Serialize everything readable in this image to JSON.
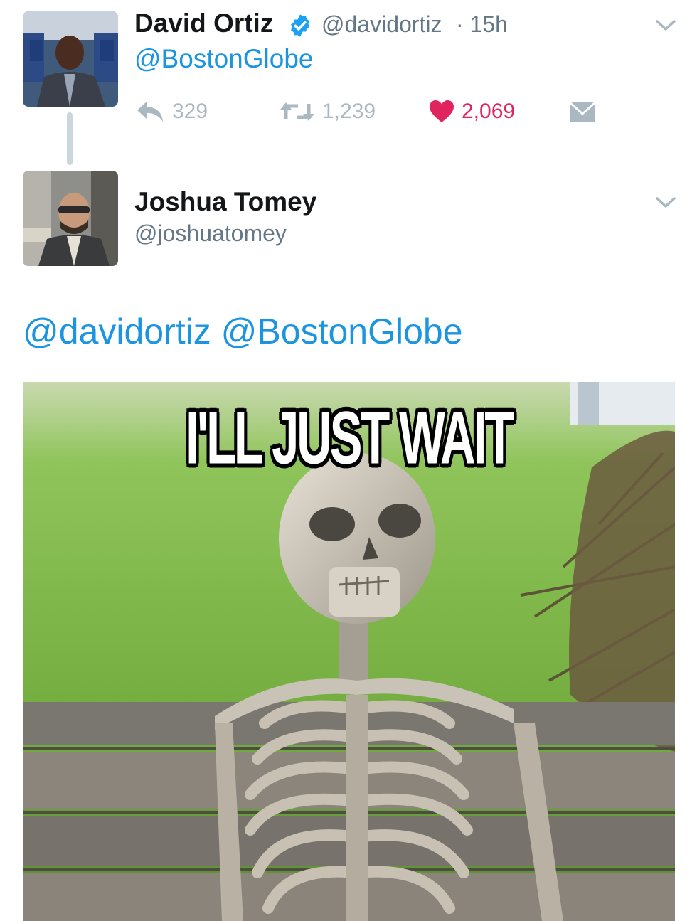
{
  "tweets": [
    {
      "name": "David Ortiz",
      "handle": "@davidortiz",
      "time": "· 15h",
      "text": "@BostonGlobe",
      "actions": {
        "replies": "329",
        "retweets": "1,239",
        "likes": "2,069"
      }
    },
    {
      "name": "Joshua Tomey",
      "handle": "@joshuatomey",
      "mentions": [
        "@davidortiz",
        "@BostonGlobe"
      ],
      "image_caption": "I'LL JUST WAIT"
    }
  ],
  "colors": {
    "link": "#1b95e0",
    "like": "#e0245e",
    "muted": "#aab8c2",
    "verified": "#1da1f2"
  },
  "icons": [
    "verified-badge-icon",
    "chevron-down-icon",
    "reply-icon",
    "retweet-icon",
    "heart-icon",
    "dm-envelope-icon"
  ]
}
